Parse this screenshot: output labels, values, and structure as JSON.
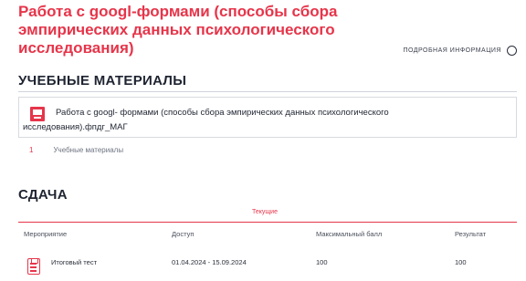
{
  "page": {
    "title": "Работа с googl-формами (способы сбора эмпирических данных психологического исследования)",
    "more_info": "ПОДРОБНАЯ ИНФОРМАЦИЯ"
  },
  "materials": {
    "heading": "УЧЕБНЫЕ МАТЕРИАЛЫ",
    "item_line1": "Работа с googl- формами (способы сбора эмпирических данных психологического",
    "item_line2": "исследования).фпдг_МАГ",
    "pager_number": "1",
    "pager_label": "Учебные материалы"
  },
  "submission": {
    "heading": "СДАЧА",
    "tab_current": "Текущие",
    "columns": {
      "event": "Мероприятие",
      "access": "Доступ",
      "max_score": "Максимальный балл",
      "result": "Результат"
    },
    "rows": [
      {
        "event": "Итоговый тест",
        "access": "01.04.2024 - 15.09.2024",
        "max_score": "100",
        "result": "100"
      }
    ]
  },
  "colors": {
    "accent": "#e6354a",
    "text": "#1f2431",
    "border": "#d7dadf"
  },
  "icons": {
    "info": "info-circle-icon",
    "material": "document-icon",
    "test": "clipboard-test-icon"
  }
}
